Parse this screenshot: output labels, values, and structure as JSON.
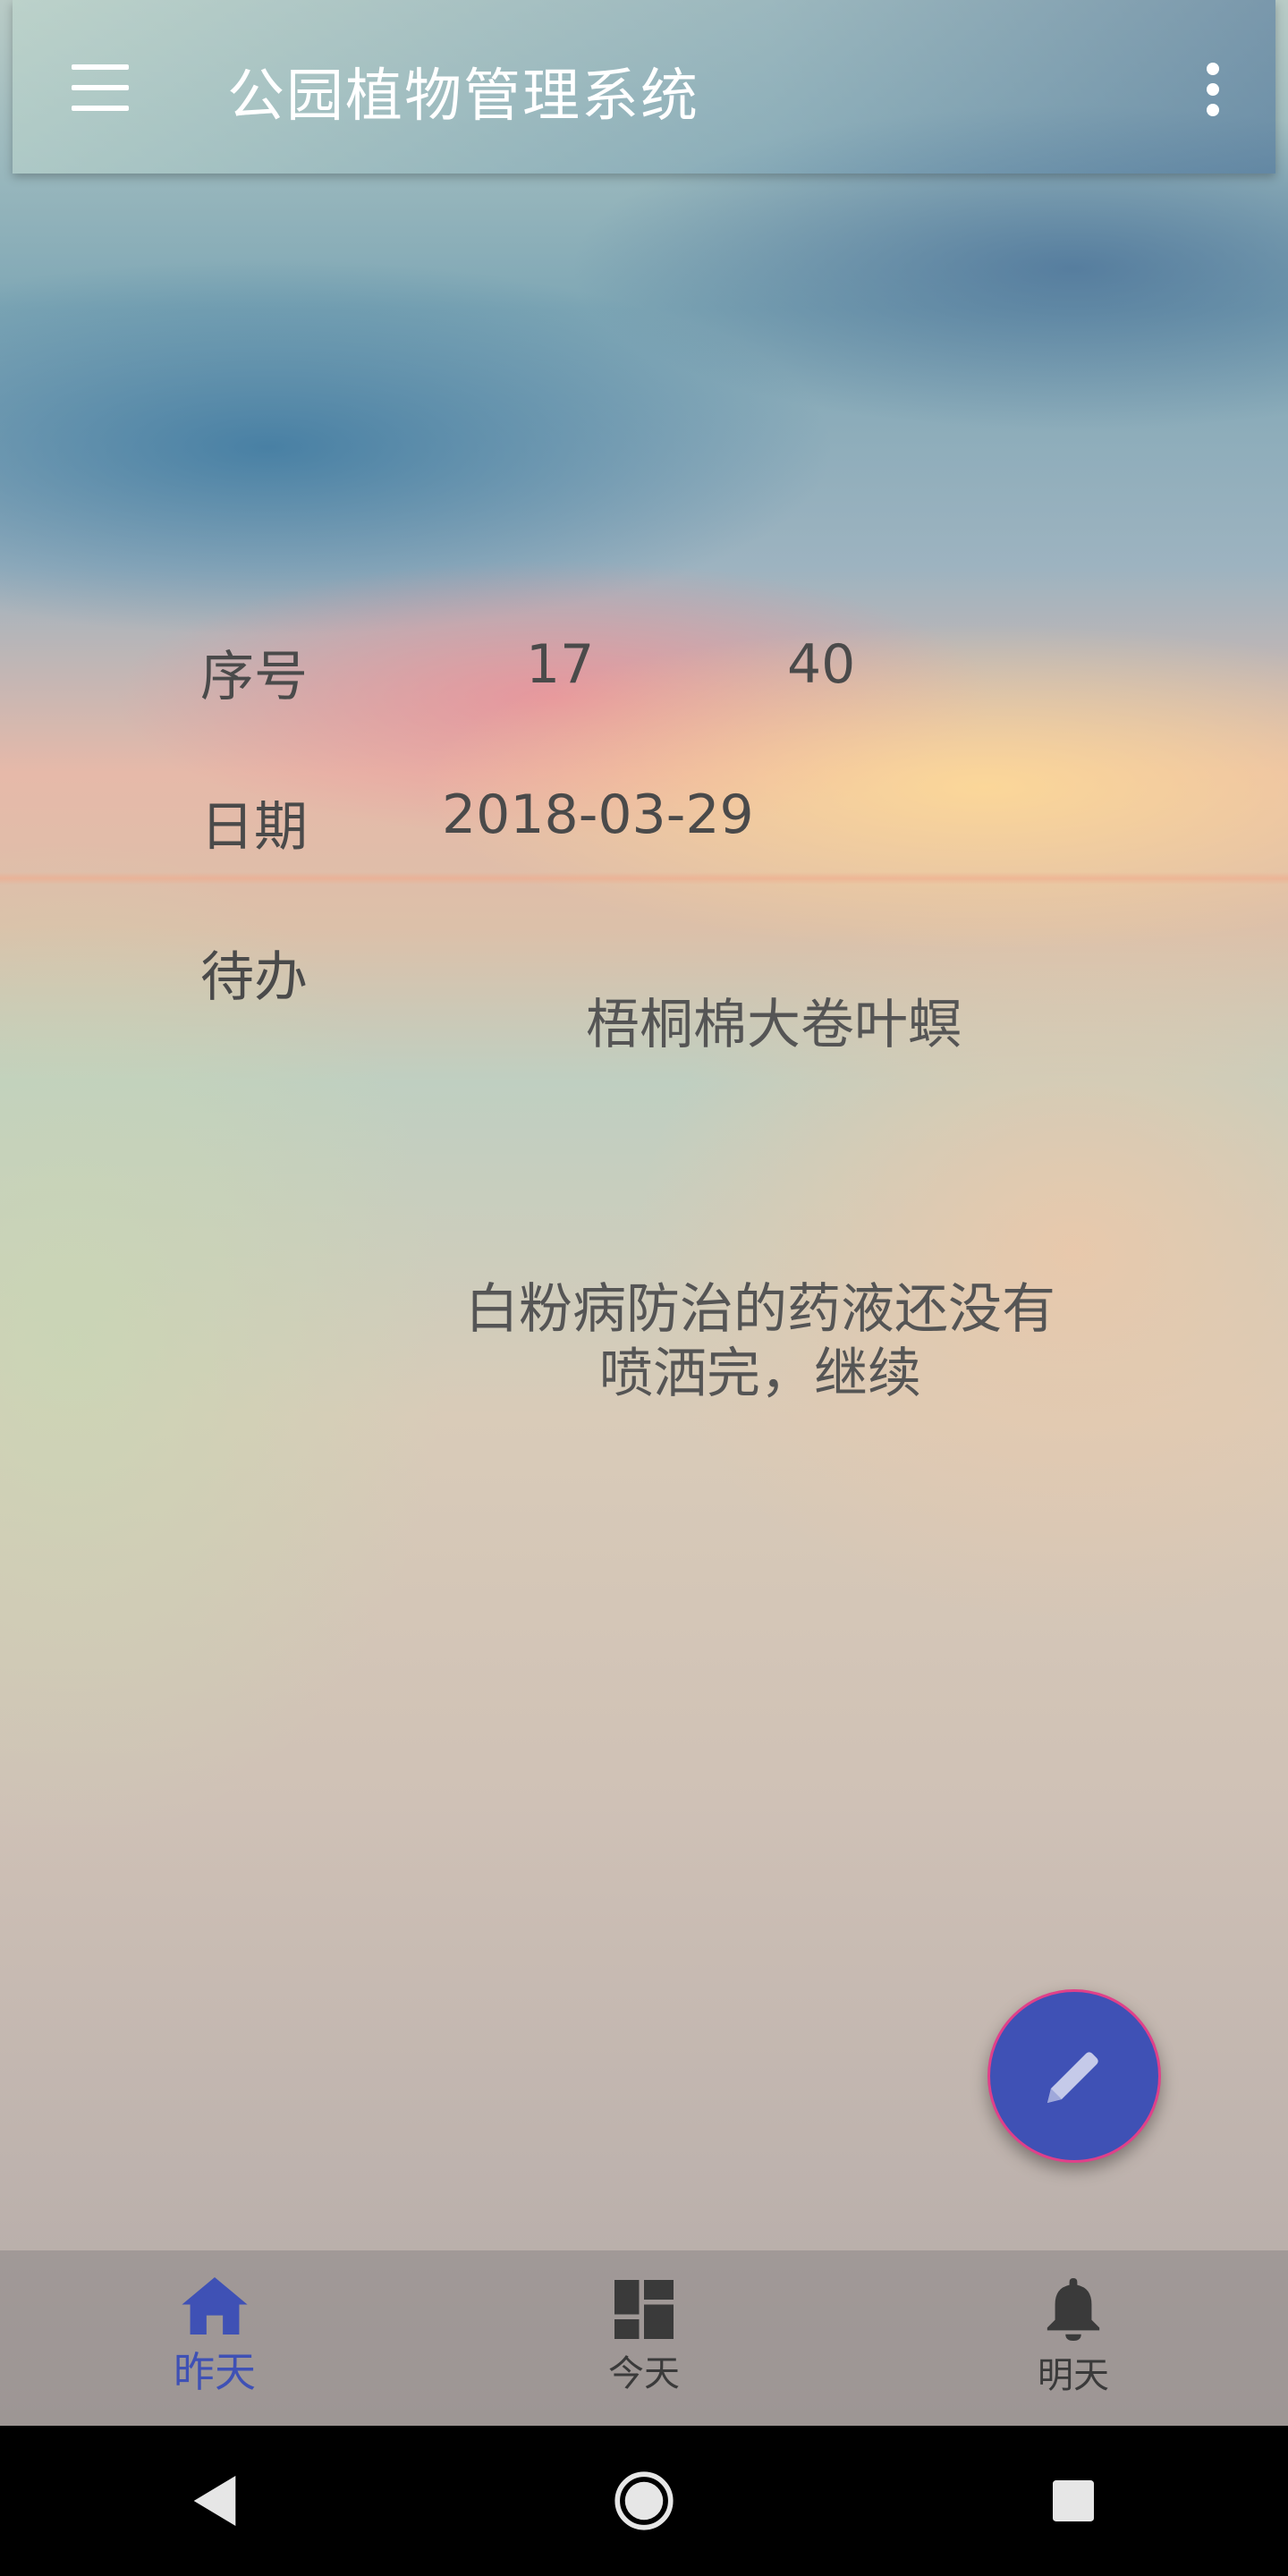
{
  "app_bar": {
    "title": "公园植物管理系统",
    "menu_icon": "menu-icon",
    "more_icon": "more-vert-icon"
  },
  "record": {
    "serial_label": "序号",
    "serial_value_1": "17",
    "serial_value_2": "40",
    "date_label": "日期",
    "date_value": "2018-03-29",
    "todo_label": "待办",
    "todo_title": "梧桐棉大卷叶螟",
    "todo_detail_line1": "白粉病防治的药液还没有",
    "todo_detail_line2": "喷洒完，继续"
  },
  "fab": {
    "icon": "pencil-icon"
  },
  "bottom_nav": {
    "items": [
      {
        "label": "昨天",
        "icon": "home-icon",
        "active": true
      },
      {
        "label": "今天",
        "icon": "dashboard-icon",
        "active": false
      },
      {
        "label": "明天",
        "icon": "bell-icon",
        "active": false
      }
    ]
  },
  "system_nav": {
    "back_icon": "back-triangle-icon",
    "home_icon": "home-circle-icon",
    "recents_icon": "recents-square-icon"
  },
  "colors": {
    "accent": "#3f51b5",
    "fab_border": "#e0408a",
    "text": "#4a4a4a"
  }
}
